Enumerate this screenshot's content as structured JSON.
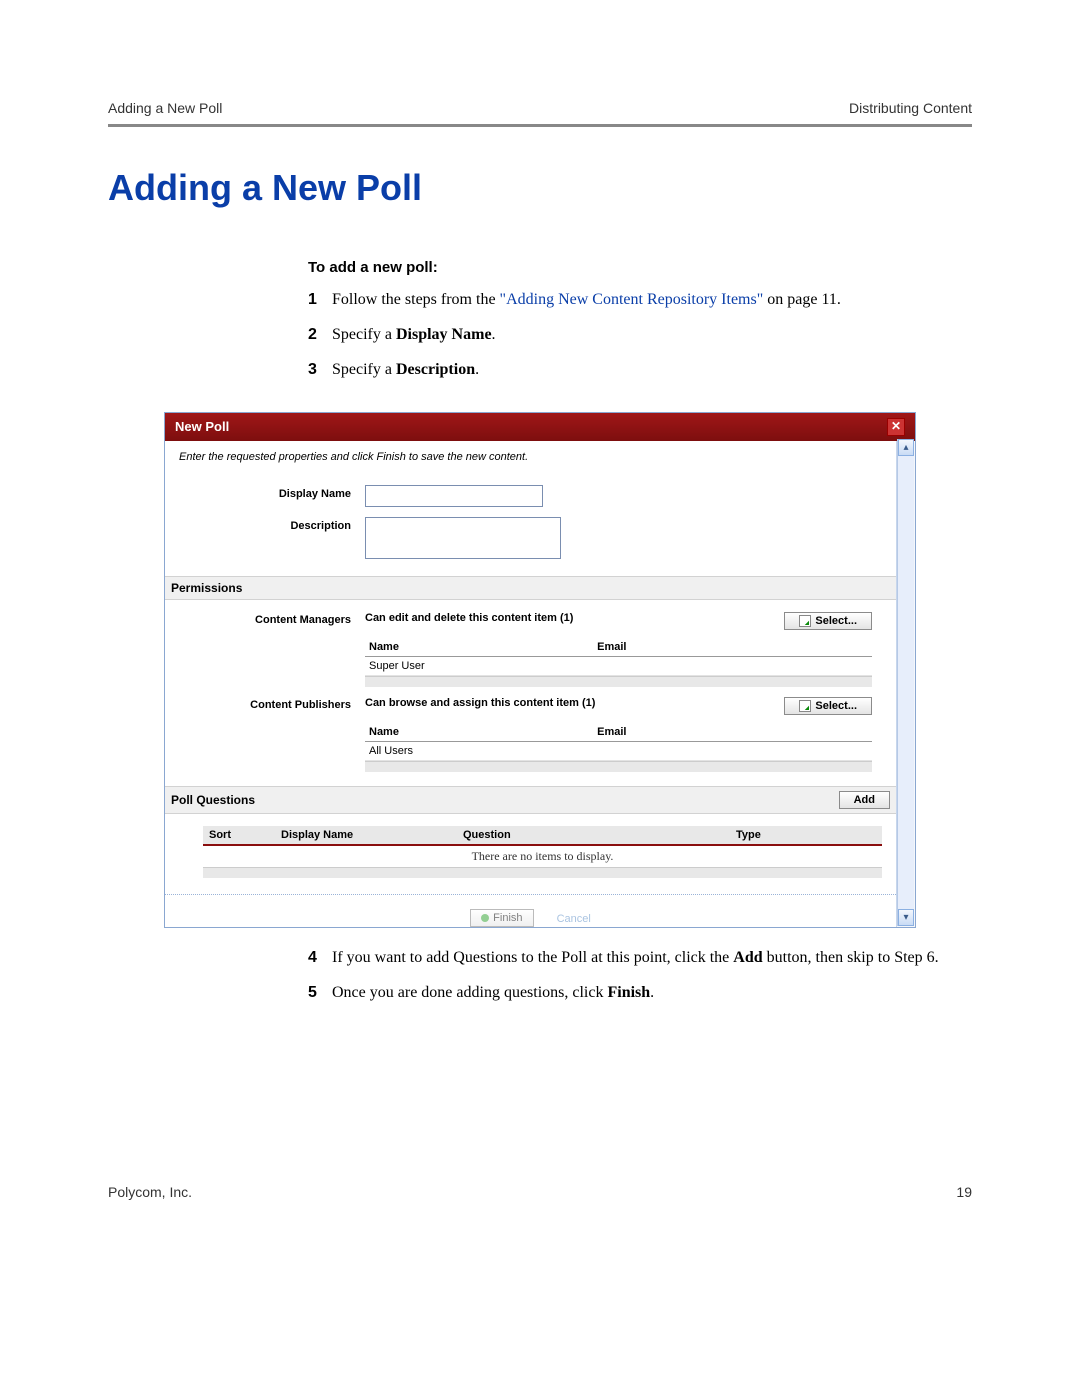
{
  "header": {
    "left": "Adding a New Poll",
    "right": "Distributing Content"
  },
  "title": "Adding a New Poll",
  "subhead": "To add a new poll:",
  "steps_top": [
    {
      "n": "1",
      "pre": "Follow the steps from the ",
      "link": "\"Adding New Content Repository Items\"",
      "post": " on page 11."
    },
    {
      "n": "2",
      "pre": "Specify a ",
      "bold": "Display Name",
      "post": "."
    },
    {
      "n": "3",
      "pre": "Specify a ",
      "bold": "Description",
      "post": "."
    }
  ],
  "steps_bottom": [
    {
      "n": "4",
      "pre": "If you want to add Questions to the Poll at this point, click the ",
      "bold": "Add",
      "post": " button, then skip to Step 6."
    },
    {
      "n": "5",
      "pre": "Once you are done adding questions, click ",
      "bold": "Finish",
      "post": "."
    }
  ],
  "dialog": {
    "title": "New Poll",
    "instruction": "Enter the requested properties and click Finish to save the new content.",
    "labels": {
      "displayName": "Display Name",
      "description": "Description"
    },
    "sections": {
      "permissions": {
        "title": "Permissions",
        "managers": {
          "label": "Content Managers",
          "desc": "Can edit and delete this content item  (1)",
          "select": "Select...",
          "cols": {
            "name": "Name",
            "email": "Email"
          },
          "rows": [
            {
              "name": "Super User",
              "email": ""
            }
          ]
        },
        "publishers": {
          "label": "Content Publishers",
          "desc": "Can browse and assign this content item  (1)",
          "select": "Select...",
          "cols": {
            "name": "Name",
            "email": "Email"
          },
          "rows": [
            {
              "name": "All Users",
              "email": ""
            }
          ]
        }
      },
      "questions": {
        "title": "Poll Questions",
        "add": "Add",
        "cols": {
          "sort": "Sort",
          "displayName": "Display Name",
          "question": "Question",
          "type": "Type"
        },
        "empty": "There are no items to display."
      }
    },
    "buttons": {
      "finish": "Finish",
      "cancel": "Cancel"
    }
  },
  "footer": {
    "left": "Polycom, Inc.",
    "right": "19"
  }
}
